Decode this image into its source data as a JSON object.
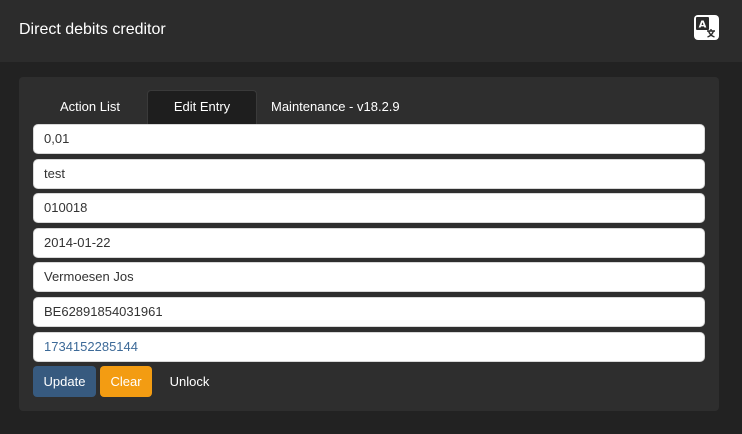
{
  "app": {
    "title": "Direct debits creditor",
    "translate_icon": "translate-icon"
  },
  "tabs": [
    {
      "label": "Action List",
      "active": false
    },
    {
      "label": "Edit Entry",
      "active": true
    },
    {
      "label": "Maintenance - v18.2.9",
      "active": false
    }
  ],
  "fields": [
    {
      "value": "0,01"
    },
    {
      "value": "test"
    },
    {
      "value": "010018"
    },
    {
      "value": "2014-01-22"
    },
    {
      "value": "Vermoesen Jos"
    },
    {
      "value": "BE62891854031961"
    },
    {
      "value": "1734152285144"
    }
  ],
  "actions": {
    "update_label": "Update",
    "clear_label": "Clear",
    "unlock_label": "Unlock"
  },
  "colors": {
    "update": "#375a7f",
    "clear": "#f39c12",
    "link_text": "#3d6a98"
  }
}
